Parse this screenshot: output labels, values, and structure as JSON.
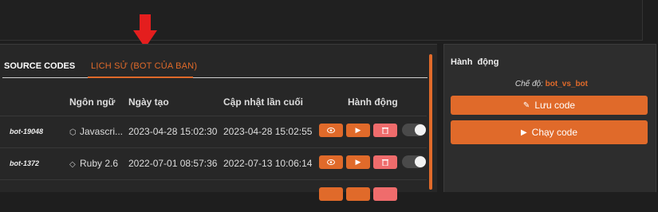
{
  "tabs": {
    "source": "SOURCE CODES",
    "history": "LỊCH SỬ (BOT CỦA BẠN)"
  },
  "table": {
    "headers": {
      "language": "Ngôn ngữ",
      "created": "Ngày tạo",
      "updated": "Cập nhật lần cuối",
      "actions": "Hành động"
    },
    "rows": [
      {
        "name": "bot-19048",
        "language": "Javascri...",
        "language_icon": "hexagon-node-icon",
        "created": "2023-04-28 15:02:30",
        "updated": "2023-04-28 15:02:55"
      },
      {
        "name": "bot-1372",
        "language": "Ruby 2.6",
        "language_icon": "ruby-gem-icon",
        "created": "2022-07-01 08:57:36",
        "updated": "2022-07-13 10:06:14"
      }
    ]
  },
  "sidebar": {
    "title": "Hành động",
    "mode_label": "Chế độ:",
    "mode_value": "bot_vs_bot",
    "save_label": "Lưu code",
    "run_label": "Chạy code"
  },
  "colors": {
    "accent": "#e06a2a",
    "danger": "#ef6c6c",
    "arrow": "#e41e1e"
  }
}
